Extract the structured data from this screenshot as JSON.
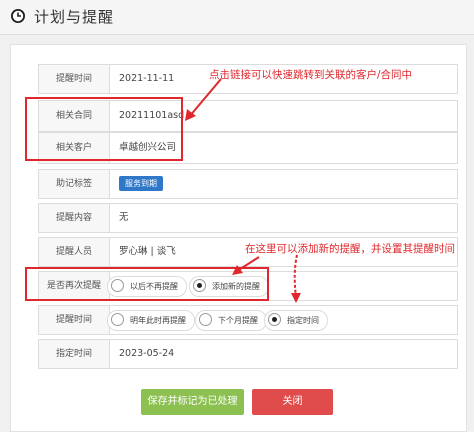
{
  "header": {
    "title": "计划与提醒",
    "icon": "clock-icon"
  },
  "rows": [
    {
      "label": "提醒时间",
      "value": "2021-11-11"
    },
    {
      "label": "相关合同",
      "value": "20211101asd"
    },
    {
      "label": "相关客户",
      "value": "卓越创兴公司"
    },
    {
      "label": "助记标签",
      "badge": "服务到期"
    },
    {
      "label": "提醒内容",
      "value": "无"
    },
    {
      "label": "提醒人员",
      "value": "罗心琳 | 谈飞"
    },
    {
      "label": "是否再次提醒",
      "options": [
        "以后不再提醒",
        "添加新的提醒"
      ],
      "selected": 1
    },
    {
      "label": "提醒时间",
      "options": [
        "明年此时再提醒",
        "下个月提醒",
        "指定时间"
      ],
      "selected": 2
    },
    {
      "label": "指定时间",
      "value": "2023-05-24"
    }
  ],
  "annotations": {
    "top": "点击链接可以快速跳转到关联的客户/合同中",
    "middle": "在这里可以添加新的提醒，并设置其提醒时间"
  },
  "buttons": {
    "save": "保存并标记为已处理",
    "close": "关闭"
  },
  "colors": {
    "annotation_red": "#e0272d",
    "save_green": "#8cc152",
    "close_red": "#e04b4b",
    "badge_blue": "#2f77c8"
  }
}
